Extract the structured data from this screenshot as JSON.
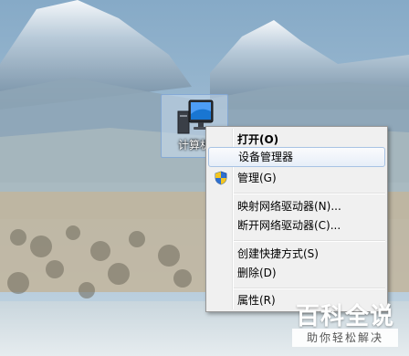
{
  "desktop": {
    "icon": {
      "name": "computer-icon",
      "label": "计算机"
    }
  },
  "context_menu": {
    "items": [
      {
        "label": "打开(O)",
        "bold": true
      },
      {
        "label": "设备管理器",
        "highlighted": true
      },
      {
        "label": "管理(G)",
        "icon": "uac-shield-icon"
      },
      {
        "label": "映射网络驱动器(N)..."
      },
      {
        "label": "断开网络驱动器(C)..."
      },
      {
        "label": "创建快捷方式(S)"
      },
      {
        "label": "删除(D)"
      },
      {
        "label": "属性(R)"
      }
    ]
  },
  "watermark": {
    "title": "百科全说",
    "subtitle": "助你轻松解决"
  }
}
